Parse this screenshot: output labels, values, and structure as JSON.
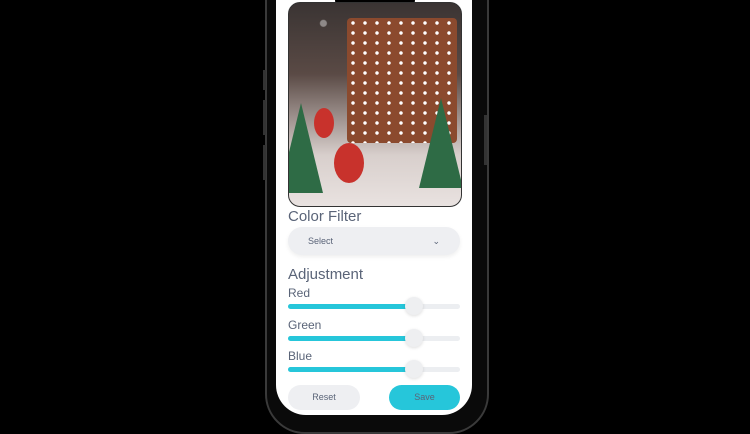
{
  "filter": {
    "title": "Color Filter",
    "select_value": "Select"
  },
  "adjustment": {
    "title": "Adjustment",
    "sliders": [
      {
        "label": "Red",
        "value": 0.73
      },
      {
        "label": "Green",
        "value": 0.73
      },
      {
        "label": "Blue",
        "value": 0.73
      }
    ]
  },
  "buttons": {
    "reset": "Reset",
    "save": "Save"
  },
  "colors": {
    "accent": "#26c6da",
    "text": "#5a6478"
  }
}
